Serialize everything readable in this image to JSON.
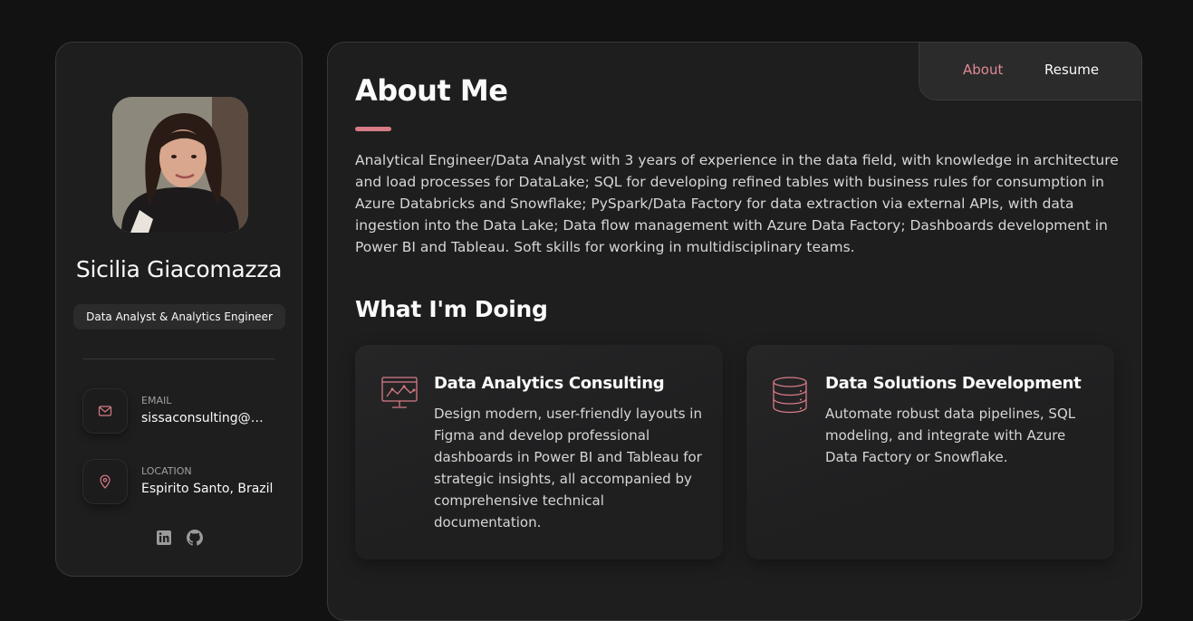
{
  "profile": {
    "name": "Sicilia Giacomazza",
    "title": "Data Analyst & Analytics Engineer",
    "avatar_icon": "profile-photo"
  },
  "contacts": [
    {
      "icon": "mail-icon",
      "label": "Email",
      "value": "sissaconsulting@gmail.com"
    },
    {
      "icon": "map-pin-icon",
      "label": "Location",
      "value": "Espirito Santo, Brazil"
    }
  ],
  "socials": [
    {
      "icon": "linkedin-icon"
    },
    {
      "icon": "github-icon"
    }
  ],
  "nav": {
    "items": [
      {
        "label": "About",
        "active": true
      },
      {
        "label": "Resume",
        "active": false
      }
    ]
  },
  "about": {
    "heading": "About Me",
    "text": "Analytical Engineer/Data Analyst with 3 years of experience in the data field, with knowledge in architecture and load processes for DataLake; SQL for developing refined tables with business rules for consumption in Azure Databricks and Snowflake; PySpark/Data Factory for data extraction via external APIs, with data ingestion into the Data Lake; Data flow management with Azure Data Factory; Dashboards development in Power BI and Tableau. Soft skills for working in multidisciplinary teams."
  },
  "services": {
    "heading": "What I'm Doing",
    "items": [
      {
        "icon": "dashboard-monitor-icon",
        "title": "Data Analytics Consulting",
        "text": "Design modern, user-friendly layouts in Figma and develop professional dashboards in Power BI and Tableau for strategic insights, all accompanied by comprehensive technical documentation."
      },
      {
        "icon": "database-icon",
        "title": "Data Solutions Development",
        "text": "Automate robust data pipelines, SQL modeling, and integrate with Azure Data Factory or Snowflake."
      }
    ]
  },
  "colors": {
    "accent": "#d77b86",
    "background": "#121212",
    "panel": "#1e1e1f"
  }
}
